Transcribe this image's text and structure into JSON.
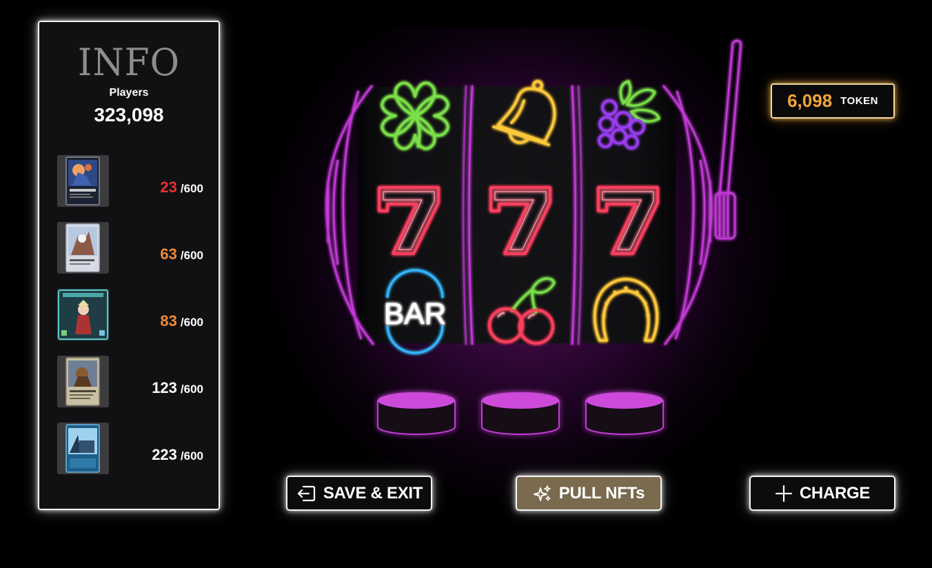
{
  "info": {
    "title": "INFO",
    "players_label": "Players",
    "players_count": "323,098",
    "cards": [
      {
        "count": "23",
        "total": "/600",
        "color": "#e8322f"
      },
      {
        "count": "63",
        "total": "/600",
        "color": "#f08a3c"
      },
      {
        "count": "83",
        "total": "/600",
        "color": "#f08a3c"
      },
      {
        "count": "123",
        "total": "/600",
        "color": "#ffffff"
      },
      {
        "count": "223",
        "total": "/600",
        "color": "#ffffff"
      }
    ]
  },
  "reels": [
    [
      "clover-icon",
      "seven-icon",
      "bar-icon"
    ],
    [
      "bell-icon",
      "seven-icon",
      "cherry-icon"
    ],
    [
      "grapes-icon",
      "seven-icon",
      "horseshoe-icon"
    ]
  ],
  "bar_symbol_text": "BAR",
  "token": {
    "amount": "6,098",
    "unit": "TOKEN"
  },
  "buttons": {
    "save_exit": "SAVE & EXIT",
    "pull_nfts": "PULL NFTs",
    "charge": "CHARGE"
  },
  "colors": {
    "neon_purple": "#c23ad6",
    "neon_green": "#7be04a",
    "neon_yellow": "#ffc83a",
    "neon_red": "#ff3f5e",
    "neon_blue": "#35b6ff",
    "token_orange": "#f5a33a",
    "pull_button_bg": "#7a6a4e"
  }
}
